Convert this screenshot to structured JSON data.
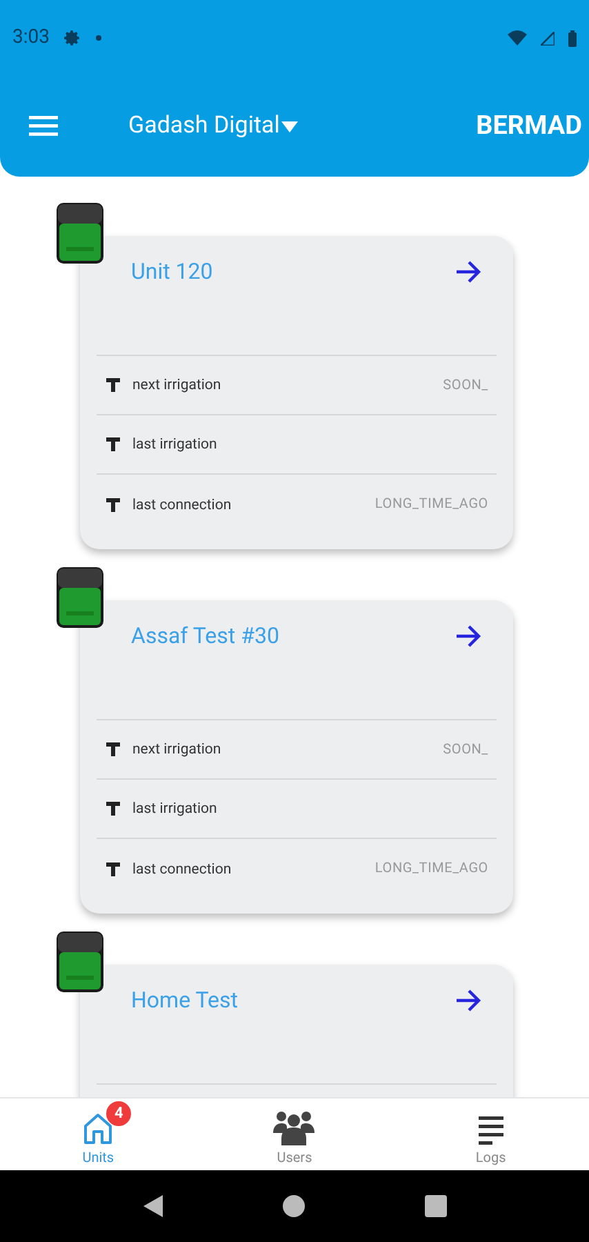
{
  "status_bar": {
    "time": "3:03"
  },
  "app_bar": {
    "account": "Gadash Digital",
    "brand": "BERMAD"
  },
  "units": [
    {
      "name": "Unit 120",
      "rows": [
        {
          "label": "next irrigation",
          "value": "SOON_"
        },
        {
          "label": "last irrigation"
        },
        {
          "label": "last connection",
          "value": "LONG_TIME_AGO"
        }
      ]
    },
    {
      "name": "Assaf Test #30",
      "rows": [
        {
          "label": "next irrigation",
          "value": "SOON_"
        },
        {
          "label": "last irrigation"
        },
        {
          "label": "last connection",
          "value": "LONG_TIME_AGO"
        }
      ]
    },
    {
      "name": "Home Test"
    }
  ],
  "tabs": [
    {
      "kind": "units",
      "label": "Units",
      "selected": true,
      "badge": "4"
    },
    {
      "kind": "users",
      "label": "Users",
      "selected": false
    },
    {
      "kind": "logs",
      "label": "Logs",
      "selected": false
    }
  ]
}
